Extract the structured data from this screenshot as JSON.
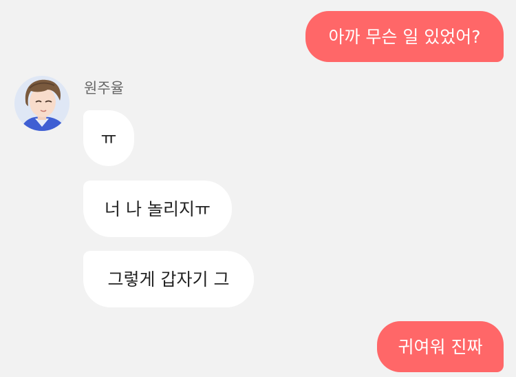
{
  "contact": {
    "name": "원주율"
  },
  "messages": [
    {
      "side": "sent",
      "text": "아까 무슨 일 있었어?"
    },
    {
      "side": "received",
      "text": "ㅠ"
    },
    {
      "side": "received",
      "text": "너 나 놀리지ㅠ"
    },
    {
      "side": "received",
      "text": "그렇게 갑자기 그"
    },
    {
      "side": "sent",
      "text": "귀여워 진짜"
    }
  ],
  "colors": {
    "background": "#f2f2f2",
    "sent_bubble": "#ff6768",
    "received_bubble": "#ffffff",
    "sent_text": "#ffffff",
    "received_text": "#222222"
  },
  "icons": {
    "contact_avatar": "illustrated-boy-avatar"
  }
}
